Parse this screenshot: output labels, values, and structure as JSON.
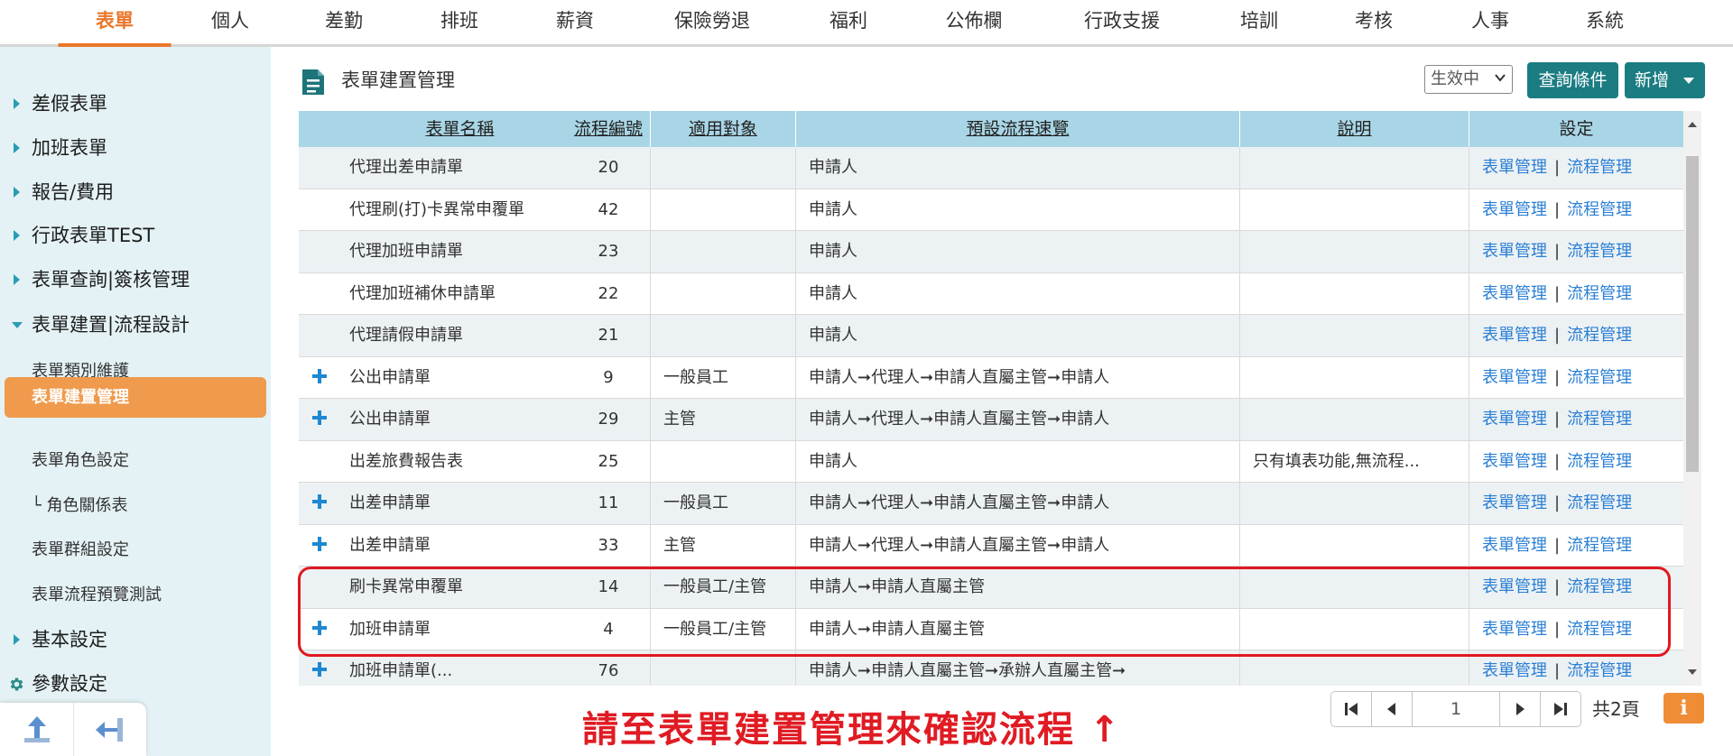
{
  "topnav": {
    "tabs": [
      {
        "label": "表單",
        "active": true
      },
      {
        "label": "個人"
      },
      {
        "label": "差勤"
      },
      {
        "label": "排班"
      },
      {
        "label": "薪資"
      },
      {
        "label": "保險勞退"
      },
      {
        "label": "福利"
      },
      {
        "label": "公佈欄"
      },
      {
        "label": "行政支援"
      },
      {
        "label": "培訓"
      },
      {
        "label": "考核"
      },
      {
        "label": "人事"
      },
      {
        "label": "系統"
      }
    ]
  },
  "sidebar": {
    "categories": [
      {
        "label": "差假表單"
      },
      {
        "label": "加班表單"
      },
      {
        "label": "報告/費用"
      },
      {
        "label": "行政表單TEST"
      },
      {
        "label": "表單查詢|簽核管理"
      },
      {
        "label": "表單建置|流程設計",
        "expanded": true
      }
    ],
    "subitems": [
      {
        "label": "表單類別維護"
      },
      {
        "label": "表單建置管理",
        "active": true
      },
      {
        "label": "表單角色設定"
      },
      {
        "label": "└ 角色關係表"
      },
      {
        "label": "表單群組設定"
      },
      {
        "label": "表單流程預覽測試"
      }
    ],
    "bottom_categories": [
      {
        "label": "基本設定",
        "icon": "caret-right-icon"
      },
      {
        "label": "參數設定",
        "icon": "gear-icon"
      }
    ]
  },
  "header": {
    "title": "表單建置管理",
    "status_select": "生效中",
    "query_button": "查詢條件",
    "add_button": "新增"
  },
  "table": {
    "columns": [
      "表單名稱",
      "流程編號",
      "適用對象",
      "預設流程速覽",
      "說明",
      "設定"
    ],
    "rows": [
      {
        "expand": false,
        "name": "代理出差申請單",
        "flow_no": "20",
        "target": "",
        "flow": "申請人",
        "desc": ""
      },
      {
        "expand": false,
        "name": "代理刷(打)卡異常申覆單",
        "flow_no": "42",
        "target": "",
        "flow": "申請人",
        "desc": ""
      },
      {
        "expand": false,
        "name": "代理加班申請單",
        "flow_no": "23",
        "target": "",
        "flow": "申請人",
        "desc": ""
      },
      {
        "expand": false,
        "name": "代理加班補休申請單",
        "flow_no": "22",
        "target": "",
        "flow": "申請人",
        "desc": ""
      },
      {
        "expand": false,
        "name": "代理請假申請單",
        "flow_no": "21",
        "target": "",
        "flow": "申請人",
        "desc": ""
      },
      {
        "expand": true,
        "name": "公出申請單",
        "flow_no": "9",
        "target": "一般員工",
        "flow": "申請人➞代理人➞申請人直屬主管➞申請人",
        "desc": ""
      },
      {
        "expand": true,
        "name": "公出申請單",
        "flow_no": "29",
        "target": "主管",
        "flow": "申請人➞代理人➞申請人直屬主管➞申請人",
        "desc": ""
      },
      {
        "expand": false,
        "name": "出差旅費報告表",
        "flow_no": "25",
        "target": "",
        "flow": "申請人",
        "desc": "只有填表功能,無流程..."
      },
      {
        "expand": true,
        "name": "出差申請單",
        "flow_no": "11",
        "target": "一般員工",
        "flow": "申請人➞代理人➞申請人直屬主管➞申請人",
        "desc": ""
      },
      {
        "expand": true,
        "name": "出差申請單",
        "flow_no": "33",
        "target": "主管",
        "flow": "申請人➞代理人➞申請人直屬主管➞申請人",
        "desc": ""
      },
      {
        "expand": false,
        "name": "刷卡異常申覆單",
        "flow_no": "14",
        "target": "一般員工/主管",
        "flow": "申請人➞申請人直屬主管",
        "desc": ""
      },
      {
        "expand": true,
        "name": "加班申請單",
        "flow_no": "4",
        "target": "一般員工/主管",
        "flow": "申請人➞申請人直屬主管",
        "desc": ""
      },
      {
        "expand": true,
        "name": "加班申請單(...",
        "flow_no": "76",
        "target": "",
        "flow": "申請人➞申請人直屬主管➞承辦人直屬主管➞",
        "desc": ""
      }
    ],
    "link_form": "表單管理",
    "link_flow": "流程管理",
    "link_sep": "|"
  },
  "annotation": "請至表單建置管理來確認流程 ↑",
  "pager": {
    "current_page": "1",
    "total": "共2頁",
    "info": "i"
  },
  "colors": {
    "accent": "#e9772a",
    "sidebar_bg": "#e4f2f5",
    "sidebar_active": "#ef9a4c",
    "teal": "#1b7c82",
    "table_head": "#a9d6e6",
    "link": "#2a7fd4",
    "highlight": "#e0181f"
  }
}
